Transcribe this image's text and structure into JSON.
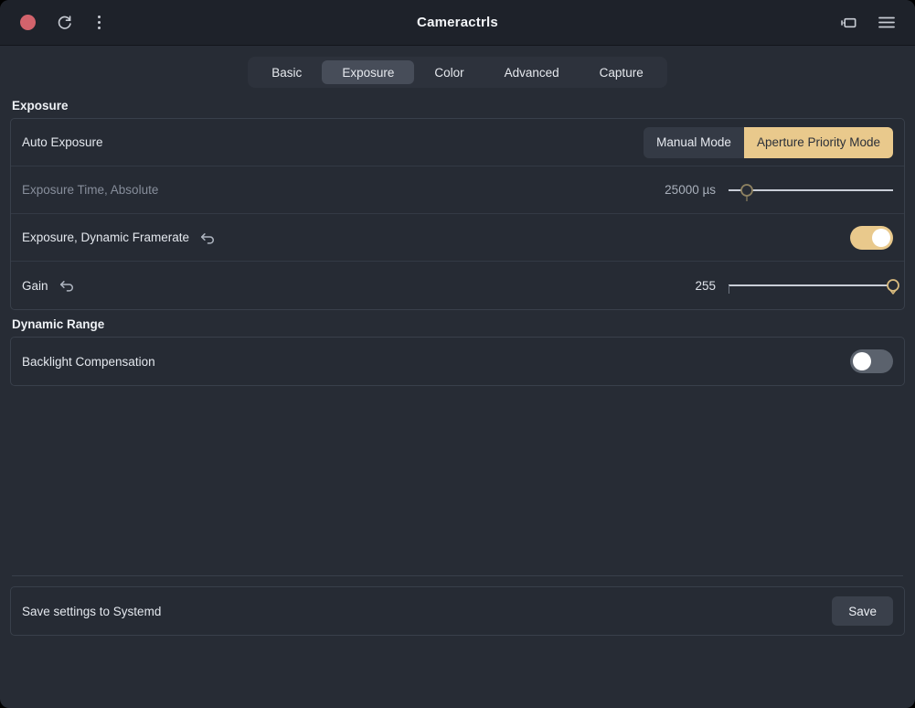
{
  "window": {
    "title": "Cameractrls",
    "accent_color": "#e9c98c",
    "record_color": "#d2636c",
    "background_color": "#272c35",
    "titlebar_color": "#1e222a"
  },
  "titlebar": {
    "record_indicator": "record-dot",
    "refresh_icon": "refresh-icon",
    "more_icon": "more-vertical-icon",
    "camera_icon": "camera-device-icon",
    "menu_icon": "hamburger-menu-icon"
  },
  "tabs": [
    {
      "label": "Basic",
      "active": false
    },
    {
      "label": "Exposure",
      "active": true
    },
    {
      "label": "Color",
      "active": false
    },
    {
      "label": "Advanced",
      "active": false
    },
    {
      "label": "Capture",
      "active": false
    }
  ],
  "sections": [
    {
      "title": "Exposure",
      "rows": [
        {
          "label": "Auto Exposure",
          "type": "segmented",
          "disabled": false,
          "has_undo": false,
          "options": [
            {
              "label": "Manual Mode",
              "selected": false
            },
            {
              "label": "Aperture Priority Mode",
              "selected": true
            }
          ]
        },
        {
          "label": "Exposure Time, Absolute",
          "type": "slider",
          "disabled": true,
          "has_undo": false,
          "value_text": "25000 µs",
          "value": 25000,
          "min": 3,
          "max": 220000,
          "percent": 11
        },
        {
          "label": "Exposure, Dynamic Framerate",
          "type": "toggle",
          "disabled": false,
          "has_undo": true,
          "on": true
        },
        {
          "label": "Gain",
          "type": "slider",
          "disabled": false,
          "has_undo": true,
          "value_text": "255",
          "value": 255,
          "min": 0,
          "max": 255,
          "percent": 100
        }
      ]
    },
    {
      "title": "Dynamic Range",
      "rows": [
        {
          "label": "Backlight Compensation",
          "type": "toggle",
          "disabled": false,
          "has_undo": false,
          "on": false
        }
      ]
    }
  ],
  "footer": {
    "label": "Save settings to Systemd",
    "save_label": "Save"
  }
}
